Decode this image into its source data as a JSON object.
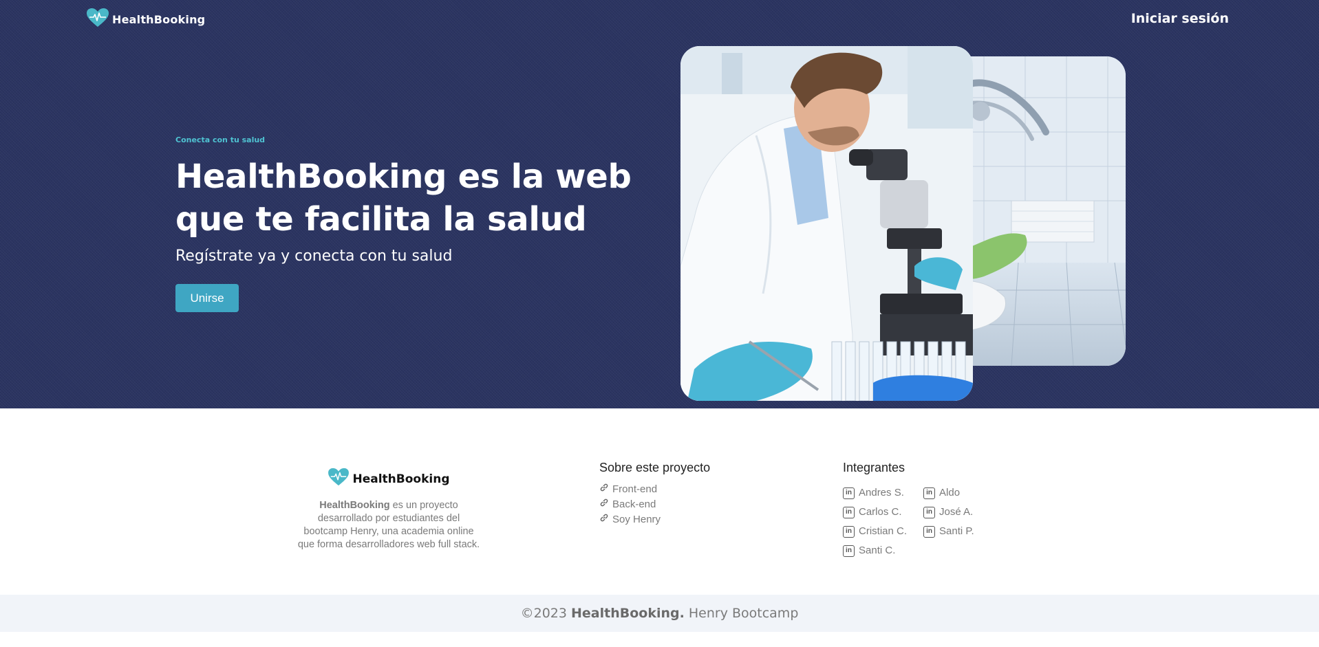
{
  "header": {
    "brand": "HealthBooking",
    "login_label": "Iniciar sesión"
  },
  "hero": {
    "kicker": "Conecta con tu salud",
    "headline_line1": "HealthBooking es la web",
    "headline_line2": "que te facilita la salud",
    "subline": "Regístrate ya y conecta con tu salud",
    "cta_label": "Unirse"
  },
  "footer": {
    "brand": "HealthBooking",
    "about_brand": "HealthBooking",
    "about_rest_1": " es un proyecto",
    "about_line_2": "desarrollado por estudiantes del",
    "about_line_3": "bootcamp Henry, una academia online",
    "about_line_4": "que forma desarrolladores web full stack.",
    "project": {
      "title": "Sobre este proyecto",
      "links": [
        "Front-end",
        "Back-end",
        "Soy Henry"
      ]
    },
    "members": {
      "title": "Integrantes",
      "left": [
        "Andres S.",
        "Carlos C.",
        "Cristian C.",
        "Santi C."
      ],
      "right": [
        "Aldo",
        "José A.",
        "Santi P."
      ]
    }
  },
  "copyright": {
    "prefix": "©2023 ",
    "brand": "HealthBooking.",
    "suffix": " Henry Bootcamp"
  },
  "colors": {
    "hero_bg": "#2b3461",
    "accent": "#3fa6c3",
    "kicker": "#4fc3d2",
    "logo_heart": "#4ab8c8",
    "footer_text": "#7a7a7a",
    "copyright_bg": "#f1f4f9"
  }
}
